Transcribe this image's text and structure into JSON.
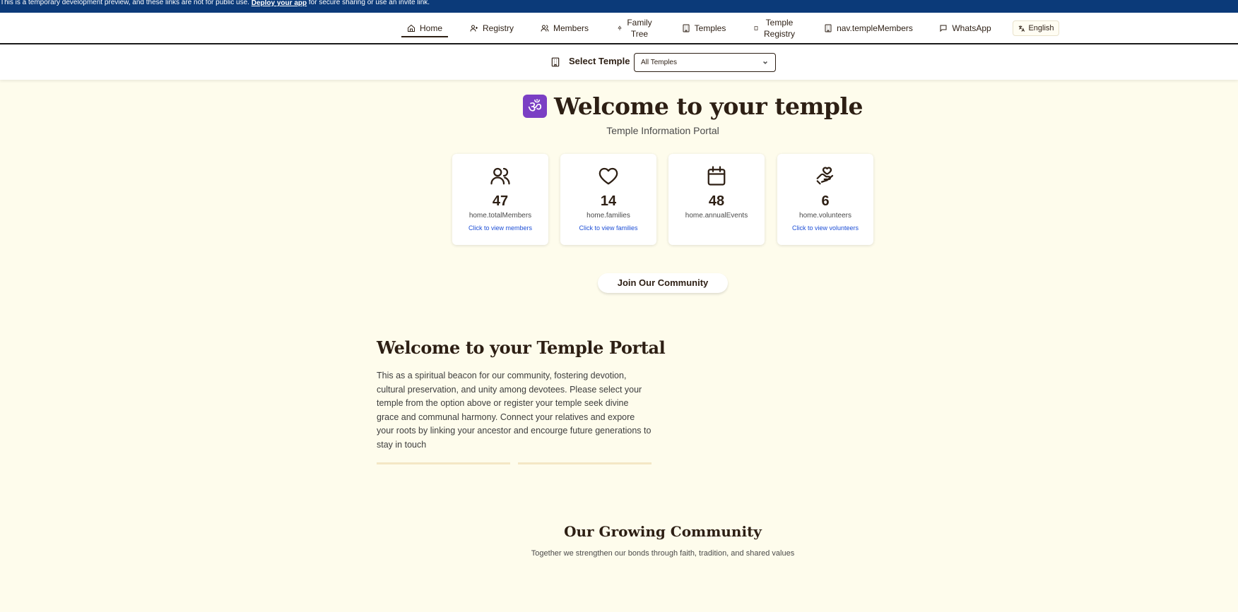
{
  "banner": {
    "text_before": "This is a temporary development preview, and these links are not for public use. ",
    "link": "Deploy your app",
    "text_after": " for secure sharing or use an invite link."
  },
  "nav": {
    "items": [
      {
        "label": "Home",
        "icon": "home-icon"
      },
      {
        "label": "Registry",
        "icon": "user-plus-icon"
      },
      {
        "label": "Members",
        "icon": "users-icon"
      },
      {
        "label": "Family Tree",
        "icon": "tree-icon"
      },
      {
        "label": "Temples",
        "icon": "building-icon"
      },
      {
        "label": "Temple Registry",
        "icon": "temple-icon"
      },
      {
        "label": "nav.templeMembers",
        "icon": "building-icon"
      },
      {
        "label": "WhatsApp",
        "icon": "message-icon"
      }
    ],
    "language": "English"
  },
  "temple_selector": {
    "label": "Select Temple",
    "selected": "All Temples"
  },
  "hero": {
    "om": "ॐ",
    "title": "Welcome to your temple",
    "subtitle": "Temple Information Portal"
  },
  "stats": [
    {
      "value": "47",
      "label": "home.totalMembers",
      "link": "Click to view members",
      "icon": "users-icon"
    },
    {
      "value": "14",
      "label": "home.families",
      "link": "Click to view families",
      "icon": "heart-icon"
    },
    {
      "value": "48",
      "label": "home.annualEvents",
      "link": "",
      "icon": "calendar-icon"
    },
    {
      "value": "6",
      "label": "home.volunteers",
      "link": "Click to view volunteers",
      "icon": "hand-heart-icon"
    }
  ],
  "join_button": "Join Our Community",
  "portal": {
    "title": "Welcome to your Temple Portal",
    "text": "This as a spiritual beacon for our community, fostering devotion, cultural preservation, and unity among devotees. Please select your temple from the option above or register your temple seek divine grace and communal harmony. Connect your relatives and expore your roots by linking your ancestor and encourge future generations to stay in touch"
  },
  "community": {
    "title": "Our Growing Community",
    "subtitle": "Together we strengthen our bonds through faith, tradition, and shared values"
  }
}
